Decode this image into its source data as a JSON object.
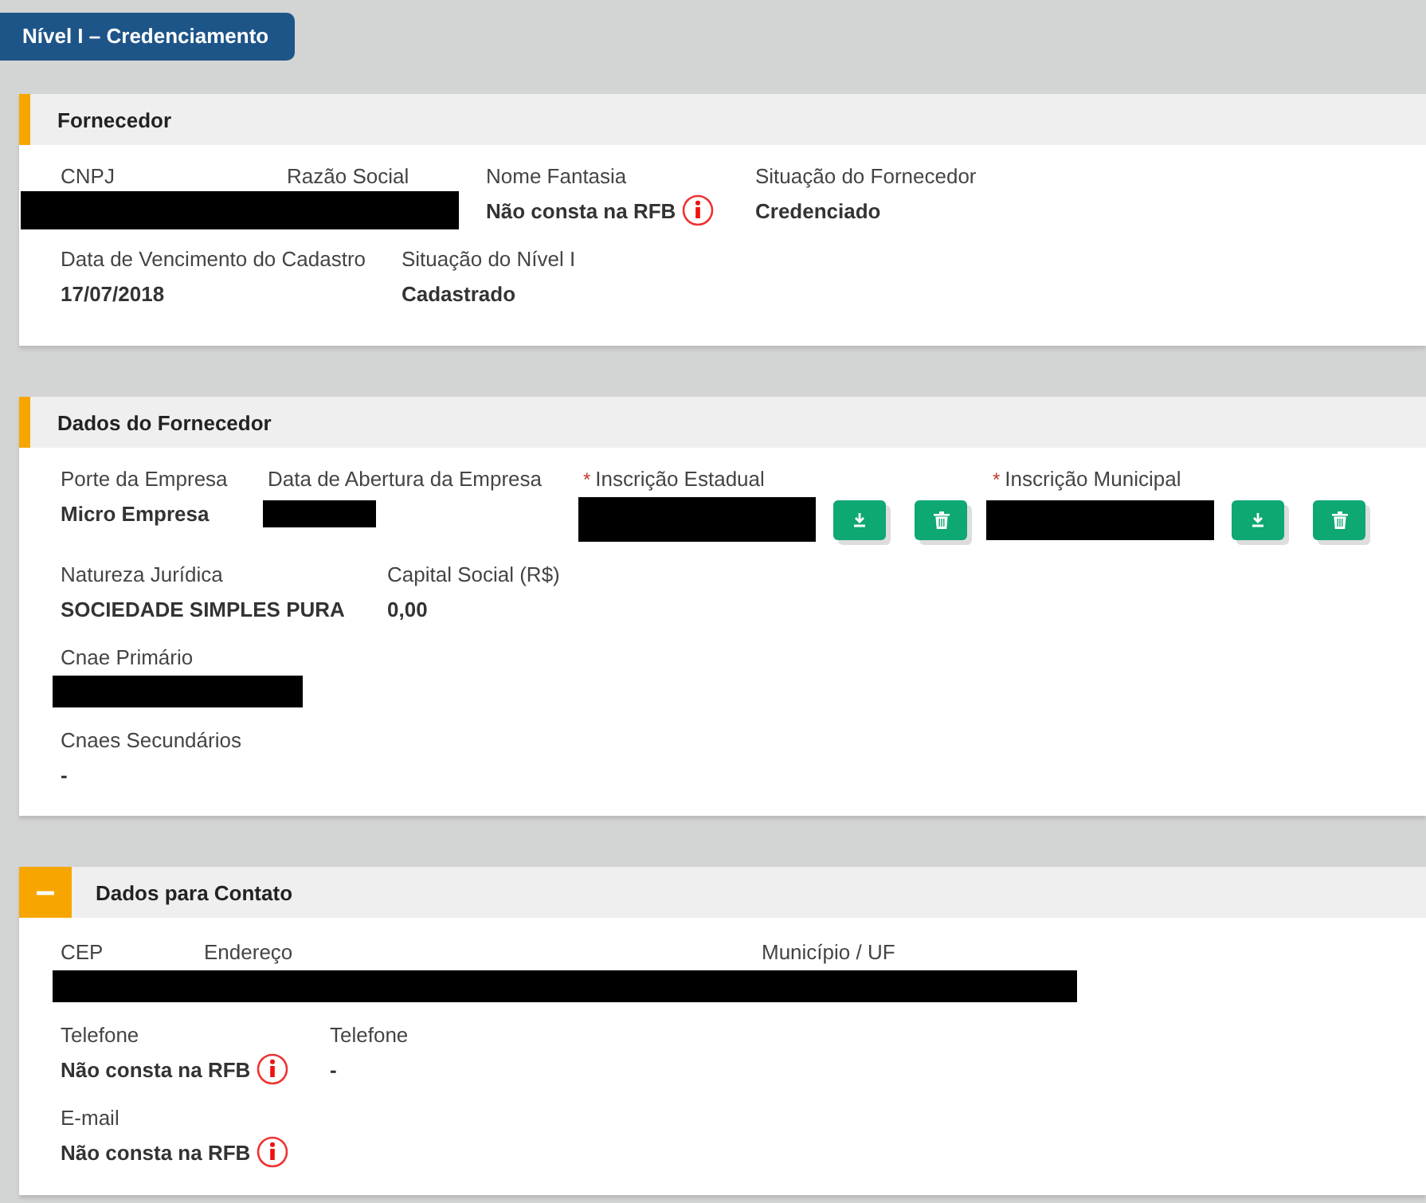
{
  "tab": {
    "label": "Nível I – Credenciamento",
    "selected": true
  },
  "sections": [
    {
      "title": "Fornecedor",
      "kind": "bar",
      "lines": [
        {
          "fields": [
            {
              "label": "CNPJ",
              "kind": "redacted"
            },
            {
              "label": "Razão Social",
              "kind": "redacted"
            },
            {
              "label": "Nome Fantasia",
              "kind": "text",
              "value": "Não consta na RFB",
              "info": true
            },
            {
              "label": "Situação do Fornecedor",
              "kind": "text",
              "value": "Credenciado"
            }
          ]
        },
        {
          "fields": [
            {
              "label": "Data de Vencimento do Cadastro",
              "kind": "text",
              "value": "17/07/2018"
            },
            {
              "label": "Situação do Nível I",
              "kind": "text",
              "value": "Cadastrado"
            }
          ]
        }
      ]
    },
    {
      "title": "Dados do Fornecedor",
      "kind": "bar",
      "lines": [
        {
          "fields": [
            {
              "label": "Porte da Empresa",
              "kind": "text",
              "value": "Micro Empresa"
            },
            {
              "label": "Data de Abertura da Empresa",
              "kind": "redacted"
            },
            {
              "label": "Inscrição Estadual",
              "required_mark": "*",
              "kind": "document",
              "actions": [
                {
                  "kind": "download"
                },
                {
                  "kind": "delete"
                }
              ]
            },
            {
              "label": "Inscrição Municipal",
              "required_mark": "*",
              "kind": "document",
              "actions": [
                {
                  "kind": "download"
                },
                {
                  "kind": "delete"
                }
              ]
            }
          ]
        },
        {
          "fields": [
            {
              "label": "Natureza Jurídica",
              "kind": "text",
              "value": "SOCIEDADE SIMPLES PURA"
            },
            {
              "label": "Capital Social (R$)",
              "kind": "text",
              "value": "0,00"
            }
          ]
        },
        {
          "fields": [
            {
              "label": "Cnae Primário",
              "kind": "redacted"
            }
          ]
        },
        {
          "fields": [
            {
              "label": "Cnaes Secundários",
              "kind": "text",
              "value": "-"
            }
          ]
        }
      ]
    },
    {
      "title": "Dados para Contato",
      "kind": "collapse",
      "expanded": true,
      "lines": [
        {
          "fields": [
            {
              "label": "CEP",
              "kind": "redacted"
            },
            {
              "label": "Endereço",
              "kind": "redacted"
            },
            {
              "label": "Município / UF",
              "kind": "redacted"
            }
          ]
        },
        {
          "fields": [
            {
              "label": "Telefone",
              "kind": "text",
              "value": "Não consta na RFB",
              "info": true
            },
            {
              "label": "Telefone",
              "kind": "text",
              "value": "-"
            }
          ]
        },
        {
          "fields": [
            {
              "label": "E-mail",
              "kind": "text",
              "value": "Não consta na RFB",
              "info": true
            }
          ]
        }
      ]
    }
  ]
}
